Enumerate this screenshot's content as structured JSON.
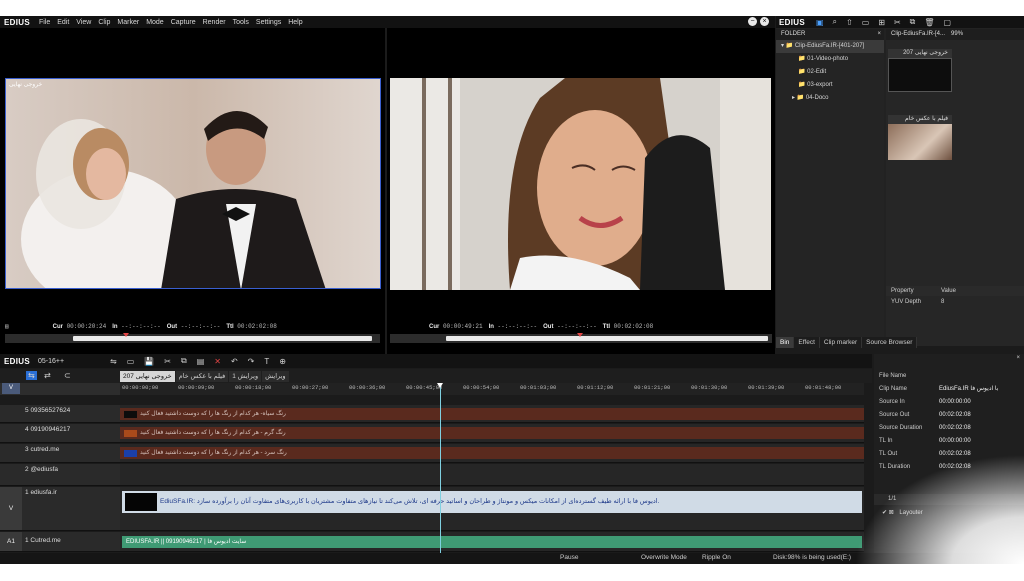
{
  "app": {
    "title": "EDIUS"
  },
  "menu": [
    "File",
    "Edit",
    "View",
    "Clip",
    "Marker",
    "Mode",
    "Capture",
    "Render",
    "Tools",
    "Settings",
    "Help"
  ],
  "player": {
    "watermark": "خروجی نهایی",
    "cur_label": "Cur",
    "cur": "00:00:20:24",
    "in_label": "In",
    "in": "--:--:--:--",
    "out_label": "Out",
    "out": "--:--:--:--",
    "ttl_label": "Ttl",
    "ttl": "00:02:02:08"
  },
  "recorder": {
    "cur_label": "Cur",
    "cur": "00:00:49:21",
    "in_label": "In",
    "in": "--:--:--:--",
    "out_label": "Out",
    "out": "--:--:--:--",
    "ttl_label": "Ttl",
    "ttl": "00:02:02:08"
  },
  "bin": {
    "brand": "EDIUS",
    "folder_header": "FOLDER",
    "folders": [
      "Clip-EdiusFa.IR-[401-207]",
      "01-Video-photo",
      "02-Edit",
      "03-export",
      "04-Doco"
    ],
    "clip_header": "Clip-EdiusFa.IR-[4...",
    "zoom": "99%",
    "clips": [
      "خروجی نهایی 207",
      "فیلم با عکس خام"
    ],
    "property_header": "Property",
    "value_header": "Value",
    "properties": [
      {
        "name": "YUV Depth",
        "value": "8"
      }
    ],
    "tabs": [
      "Bin",
      "Effect",
      "Clip marker",
      "Source Browser"
    ]
  },
  "timeline": {
    "brand": "EDIUS",
    "project": "05-16++",
    "tabs": [
      "خروجی نهایی 207",
      "فیلم با عکس خام",
      "ویرایش 1",
      "ویرایش"
    ],
    "ruler": [
      "00:00:00;00",
      "00:00:09;00",
      "00:00:18;00",
      "00:00:27;00",
      "00:00:36;00",
      "00:00:45;00",
      "00:00:54;00",
      "00:01:03;00",
      "00:01:12;00",
      "00:01:21;00",
      "00:01:30;00",
      "00:01:39;00",
      "00:01:48;00"
    ],
    "tracks": [
      {
        "num": "5",
        "name": "09356527624",
        "type": "",
        "clip": "رنگ سیاه- هر کدام از رنگ ها را که دوست داشتید فعال کنید",
        "swatch": "#0c0c0c"
      },
      {
        "num": "4",
        "name": "09190946217",
        "type": "",
        "clip": "رنگ گرم - هر کدام از رنگ ها را که دوست داشتید فعال کنید",
        "swatch": "#a94a1b"
      },
      {
        "num": "3",
        "name": "cutred.me",
        "type": "",
        "clip": "رنگ سرد - هر کدام از رنگ ها را که دوست داشتید فعال کنید",
        "swatch": "#1b3fa8"
      },
      {
        "num": "2",
        "name": "@ediusfa",
        "type": "",
        "clip": "",
        "swatch": ""
      },
      {
        "num": "1",
        "name": "ediusfa.ir",
        "type": "V",
        "clip": "EdiuSFa.IR: ادیوس فا با ارائه طیف گسترده‌ای از امکانات میکس و مونتاژ و طراحان و اساتید حرفه ای، تلاش می‌کند تا نیازهای متفاوت مشتریان با کاربری‌های متفاوت آنان را برآورده سازد.",
        "swatch": ""
      }
    ],
    "audio": {
      "type": "A1",
      "name": "1 Cutred.me",
      "clip": "EDIUSFA.IR || 09190946217 | سایت ادیوس فا"
    }
  },
  "info": {
    "rows": [
      {
        "k": "File Name",
        "v": ""
      },
      {
        "k": "Clip Name",
        "v": "EdiusFa.IR با ادیوس فا"
      },
      {
        "k": "Source In",
        "v": "00:00:00:00"
      },
      {
        "k": "Source Out",
        "v": "00:02:02:08"
      },
      {
        "k": "Source Duration",
        "v": "00:02:02:08"
      },
      {
        "k": "TL In",
        "v": "00:00:00:00"
      },
      {
        "k": "TL Out",
        "v": "00:02:02:08"
      },
      {
        "k": "TL Duration",
        "v": "00:02:02:08"
      }
    ],
    "page": "1/1",
    "layer": "Layouter"
  },
  "status": {
    "pause": "Pause",
    "mode": "Overwrite Mode",
    "ripple": "Ripple On",
    "disk": "Disk:98% is being used(E:)"
  },
  "colors": {
    "accent_play": "#46c046",
    "track_clip": "#5a2a1e",
    "selected_clip": "#d0dbe6",
    "audio_clip": "#3f9a74"
  }
}
